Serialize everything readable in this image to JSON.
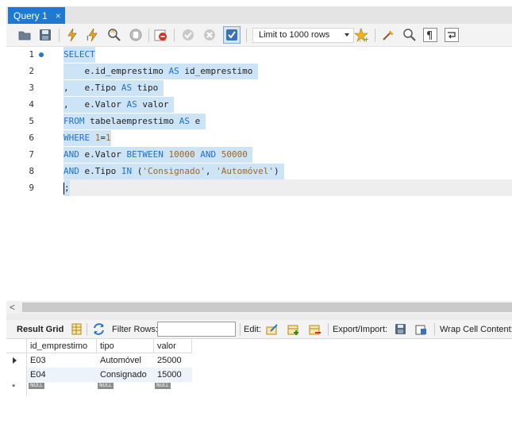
{
  "tab": {
    "title": "Query 1",
    "close": "×"
  },
  "toolbar": {
    "limit_select": "Limit to 1000 rows",
    "icons": [
      "open-folder-icon",
      "save-icon",
      "execute-icon",
      "execute-current-icon",
      "explain-icon",
      "stop-icon",
      "stop-on-error-icon",
      "commit-icon",
      "rollback-icon",
      "autocommit-icon",
      "bookmark-icon",
      "beautify-icon",
      "find-icon",
      "invisible-chars-icon",
      "wrap-icon"
    ]
  },
  "editor": {
    "line_numbers": [
      "1",
      "2",
      "3",
      "4",
      "5",
      "6",
      "7",
      "8",
      "9"
    ],
    "lines": [
      [
        {
          "t": "SELECT",
          "c": "kw"
        }
      ],
      [
        {
          "t": "    e.id_emprestimo ",
          "c": ""
        },
        {
          "t": "AS",
          "c": "kw"
        },
        {
          "t": " id_emprestimo ",
          "c": ""
        }
      ],
      [
        {
          "t": ",   e.Tipo ",
          "c": ""
        },
        {
          "t": "AS",
          "c": "kw"
        },
        {
          "t": " tipo ",
          "c": ""
        }
      ],
      [
        {
          "t": ",   e.Valor ",
          "c": ""
        },
        {
          "t": "AS",
          "c": "kw"
        },
        {
          "t": " valor ",
          "c": ""
        }
      ],
      [
        {
          "t": "FROM",
          "c": "kw"
        },
        {
          "t": " tabelaemprestimo ",
          "c": ""
        },
        {
          "t": "AS",
          "c": "kw"
        },
        {
          "t": " e ",
          "c": ""
        }
      ],
      [
        {
          "t": "WHERE",
          "c": "kw"
        },
        {
          "t": " ",
          "c": ""
        },
        {
          "t": "1",
          "c": "num"
        },
        {
          "t": "=",
          "c": ""
        },
        {
          "t": "1",
          "c": "num"
        }
      ],
      [
        {
          "t": "AND",
          "c": "kw"
        },
        {
          "t": " e.Valor ",
          "c": ""
        },
        {
          "t": "BETWEEN",
          "c": "kw"
        },
        {
          "t": " ",
          "c": ""
        },
        {
          "t": "10000",
          "c": "num"
        },
        {
          "t": " ",
          "c": ""
        },
        {
          "t": "AND",
          "c": "kw"
        },
        {
          "t": " ",
          "c": ""
        },
        {
          "t": "50000",
          "c": "num"
        },
        {
          "t": " ",
          "c": ""
        }
      ],
      [
        {
          "t": "AND",
          "c": "kw"
        },
        {
          "t": " e.Tipo ",
          "c": ""
        },
        {
          "t": "IN",
          "c": "kw"
        },
        {
          "t": " (",
          "c": ""
        },
        {
          "t": "'Consignado'",
          "c": "str"
        },
        {
          "t": ", ",
          "c": ""
        },
        {
          "t": "'Automóvel'",
          "c": "str"
        },
        {
          "t": ") ",
          "c": ""
        }
      ],
      [
        {
          "t": ";",
          "c": ""
        }
      ]
    ]
  },
  "result_toolbar": {
    "result_grid_label": "Result Grid",
    "filter_rows_label": "Filter Rows:",
    "filter_rows_value": "",
    "edit_label": "Edit:",
    "export_import_label": "Export/Import:",
    "wrap_cell_label": "Wrap Cell Content:"
  },
  "grid": {
    "columns": [
      "id_emprestimo",
      "tipo",
      "valor"
    ],
    "rows": [
      [
        "E03",
        "Automóvel",
        "25000"
      ],
      [
        "E04",
        "Consignado",
        "15000"
      ]
    ],
    "null_label": "NULL"
  },
  "colors": {
    "accent": "#1f78d1",
    "selection": "#cde4f7",
    "keyword": "#1f6fd1",
    "literal": "#a0651f"
  }
}
